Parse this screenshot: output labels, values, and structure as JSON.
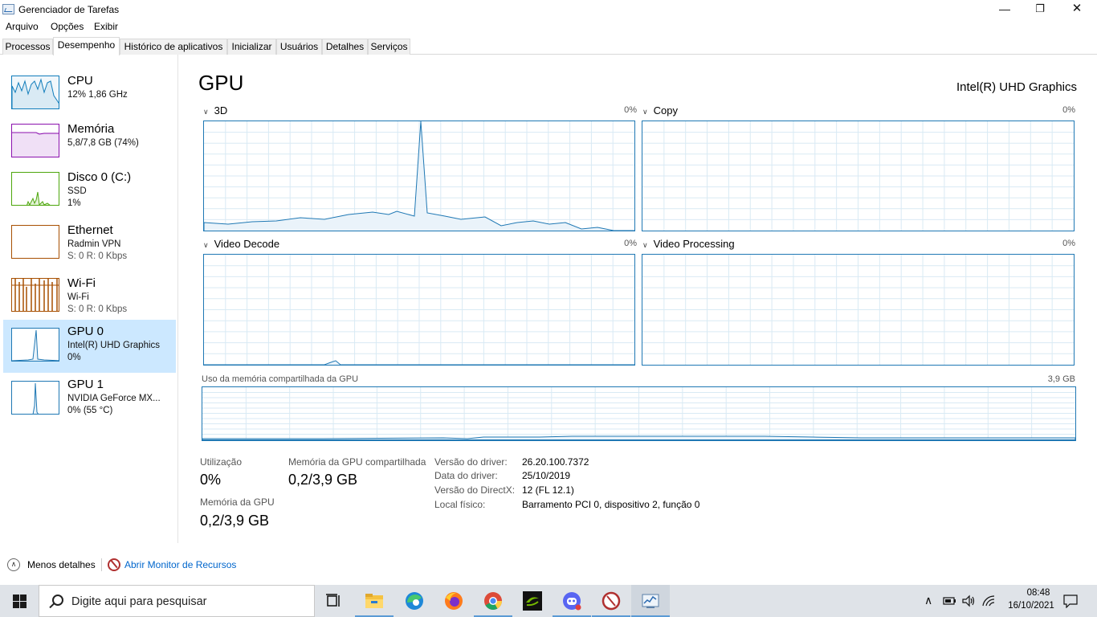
{
  "window": {
    "title": "Gerenciador de Tarefas"
  },
  "menu": [
    "Arquivo",
    "Opções",
    "Exibir"
  ],
  "tabs": [
    "Processos",
    "Desempenho",
    "Histórico de aplicativos",
    "Inicializar",
    "Usuários",
    "Detalhes",
    "Serviços"
  ],
  "active_tab": "Desempenho",
  "sidebar": [
    {
      "title": "CPU",
      "line1": "12%  1,86 GHz",
      "line2": "",
      "color": "#117dbb"
    },
    {
      "title": "Memória",
      "line1": "5,8/7,8 GB (74%)",
      "line2": "",
      "color": "#8b12ae"
    },
    {
      "title": "Disco 0 (C:)",
      "line1": "SSD",
      "line2": "1%",
      "color": "#4da60c"
    },
    {
      "title": "Ethernet",
      "line1": "Radmin VPN",
      "line2": "S: 0 R: 0 Kbps",
      "color": "#a74f01"
    },
    {
      "title": "Wi-Fi",
      "line1": "Wi-Fi",
      "line2": "S: 0 R: 0 Kbps",
      "color": "#a74f01"
    },
    {
      "title": "GPU 0",
      "line1": "Intel(R) UHD Graphics",
      "line2": "0%",
      "color": "#1f78b4"
    },
    {
      "title": "GPU 1",
      "line1": "NVIDIA GeForce MX...",
      "line2": "0%  (55 °C)",
      "color": "#1f78b4"
    }
  ],
  "selected_item": "GPU 0",
  "main": {
    "heading": "GPU",
    "model": "Intel(R) UHD Graphics",
    "engines": [
      {
        "name": "3D",
        "percent": "0%"
      },
      {
        "name": "Copy",
        "percent": "0%"
      },
      {
        "name": "Video Decode",
        "percent": "0%"
      },
      {
        "name": "Video Processing",
        "percent": "0%"
      }
    ],
    "shared_memory_title": "Uso da memória compartilhada da GPU",
    "shared_memory_max": "3,9 GB",
    "stats": {
      "utilization_label": "Utilização",
      "utilization_value": "0%",
      "shared_label": "Memória da GPU compartilhada",
      "shared_value": "0,2/3,9 GB",
      "gpu_mem_label": "Memória da GPU",
      "gpu_mem_value": "0,2/3,9 GB"
    },
    "info": [
      {
        "label": "Versão do driver:",
        "value": "26.20.100.7372"
      },
      {
        "label": "Data do driver:",
        "value": "25/10/2019"
      },
      {
        "label": "Versão do DirectX:",
        "value": "12 (FL 12.1)"
      },
      {
        "label": "Local físico:",
        "value": "Barramento PCI 0, dispositivo 2, função 0"
      }
    ]
  },
  "footer": {
    "less_details": "Menos detalhes",
    "open_monitor": "Abrir Monitor de Recursos"
  },
  "taskbar": {
    "search_placeholder": "Digite aqui para pesquisar",
    "apps": [
      "task-view",
      "file-explorer",
      "edge",
      "firefox",
      "chrome",
      "nvidia",
      "discord",
      "resource-app",
      "task-manager"
    ],
    "time": "08:48",
    "date": "16/10/2021"
  },
  "colors": {
    "gpu_accent": "#1f78b4",
    "selection": "#cce8ff",
    "link": "#0066cc"
  }
}
